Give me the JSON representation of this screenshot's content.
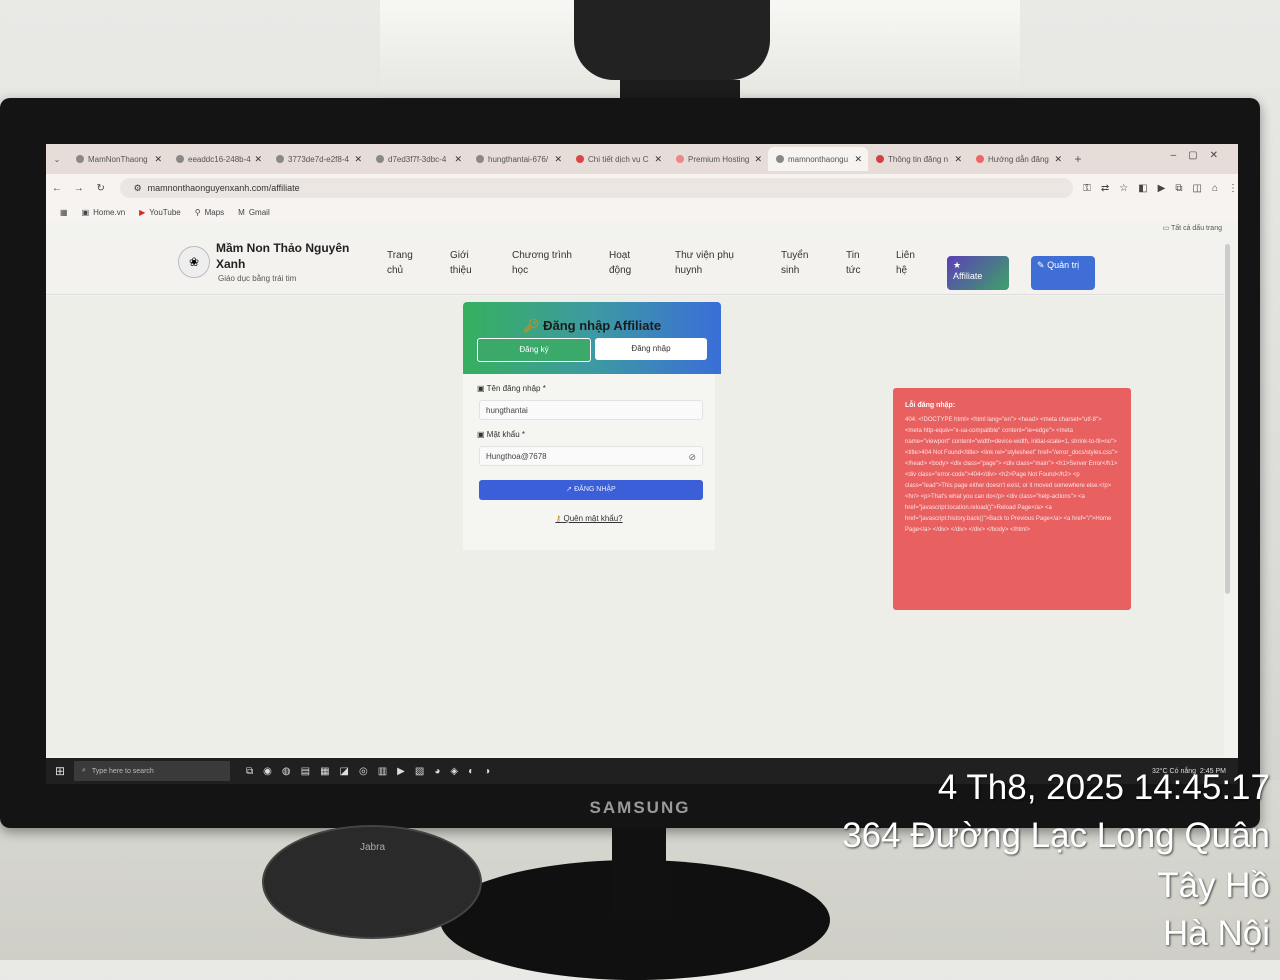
{
  "browser": {
    "tabs": [
      {
        "label": "MamNonThaong"
      },
      {
        "label": "eeaddc16-248b-4"
      },
      {
        "label": "3773de7d-e2f8-4"
      },
      {
        "label": "d7ed3f7f-3dbc-4"
      },
      {
        "label": "hungthantai-676/"
      },
      {
        "label": "Chi tiết dịch vụ C"
      },
      {
        "label": "Premium Hosting"
      },
      {
        "label": "mamnonthaongu"
      },
      {
        "label": "Thông tin đăng n"
      },
      {
        "label": "Hướng dẫn đăng"
      }
    ],
    "url": "mamnonthaonguyenxanh.com/affiliate",
    "bookmarks": [
      "Home.vn",
      "YouTube",
      "Maps",
      "Gmail"
    ],
    "all_bookmarks": "Tất cả dấu trang"
  },
  "site": {
    "name": "Mầm Non Thảo Nguyên Xanh",
    "slogan": "Giáo dục bằng trái tim",
    "nav": [
      {
        "label": "Trang chủ"
      },
      {
        "label": "Giới thiệu"
      },
      {
        "label": "Chương trình học"
      },
      {
        "label": "Hoạt động"
      },
      {
        "label": "Thư viện phụ huynh"
      },
      {
        "label": "Tuyển sinh"
      },
      {
        "label": "Tin tức"
      },
      {
        "label": "Liên hệ"
      }
    ],
    "affiliate_btn": "Affiliate",
    "admin_btn": "Quản trị"
  },
  "login": {
    "title": "Đăng nhập Affiliate",
    "tab_signup": "Đăng ký",
    "tab_login": "Đăng nhập",
    "username_label": "Tên đăng nhập *",
    "username_value": "hungthantai",
    "password_label": "Mật khẩu *",
    "password_value": "Hungthoa@7678",
    "submit": "ĐĂNG NHẬP",
    "forgot": "Quên mật khẩu?"
  },
  "error": {
    "title": "Lỗi đăng nhập:",
    "message": "404: <!DOCTYPE html> <html lang=\"en\"> <head> <meta charset=\"utf-8\"> <meta http-equiv=\"x-ua-compatible\" content=\"ie=edge\"> <meta name=\"viewport\" content=\"width=device-width, initial-scale=1, shrink-to-fit=no\"> <title>404 Not Found</title> <link rel=\"stylesheet\" href=\"/error_docs/styles.css\"> </head> <body> <div class=\"page\"> <div class=\"main\"> <h1>Server Error</h1> <div class=\"error-code\">404</div> <h2>Page Not Found</h2> <p class=\"lead\">This page either doesn't exist, or it moved somewhere else.</p> <hr/> <p>That's what you can do</p> <div class=\"help-actions\"> <a href=\"javascript:location.reload()\">Reload Page</a> <a href=\"javascript:history.back()\">Back to Previous Page</a> <a href=\"/\">Home Page</a> </div> </div> </div> </body> </html>"
  },
  "taskbar": {
    "search_placeholder": "Type here to search",
    "weather": "32°C Có nắng",
    "time": "2:45 PM"
  },
  "monitor_brand": "SAMSUNG",
  "speaker_brand": "Jabra",
  "stamp": {
    "datetime": "4 Th8, 2025 14:45:17",
    "street": "364 Đường Lạc Long Quân",
    "district": "Tây Hồ",
    "city": "Hà Nội"
  }
}
